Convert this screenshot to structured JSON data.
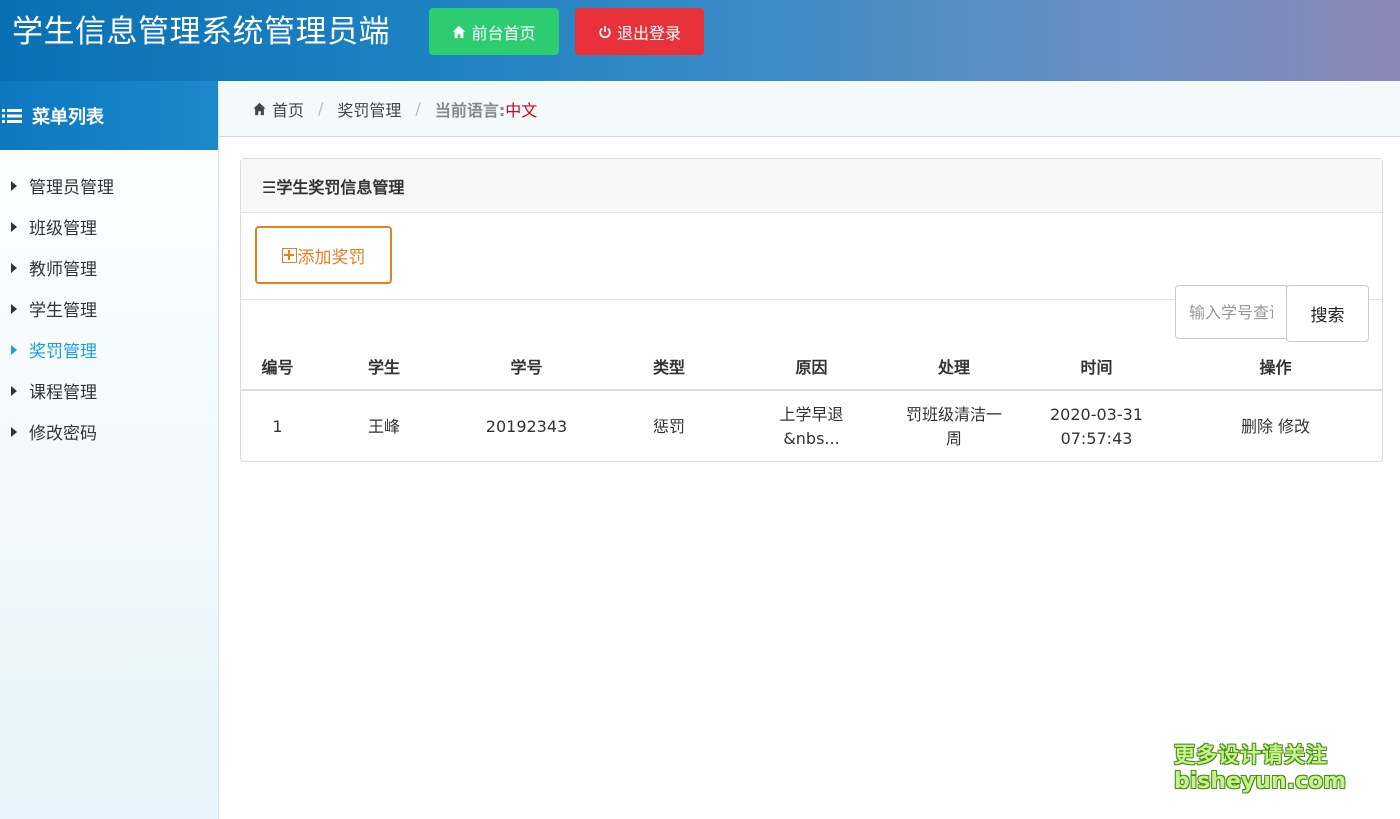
{
  "header": {
    "title": "学生信息管理系统管理员端",
    "home_button": "前台首页",
    "logout_button": "退出登录"
  },
  "sidebar": {
    "title": "菜单列表",
    "items": [
      {
        "label": "管理员管理"
      },
      {
        "label": "班级管理"
      },
      {
        "label": "教师管理"
      },
      {
        "label": "学生管理"
      },
      {
        "label": "奖罚管理"
      },
      {
        "label": "课程管理"
      },
      {
        "label": "修改密码"
      }
    ],
    "active_index": 4
  },
  "breadcrumb": {
    "home": "首页",
    "current": "奖罚管理",
    "lang_label": "当前语言:",
    "lang_value": "中文"
  },
  "panel": {
    "title": "☰学生奖罚信息管理",
    "add_button": "添加奖罚",
    "search": {
      "placeholder": "输入学号查询",
      "button": "搜索"
    }
  },
  "table": {
    "headers": [
      "编号",
      "学生",
      "学号",
      "类型",
      "原因",
      "处理",
      "时间",
      "操作"
    ],
    "rows": [
      {
        "id": "1",
        "student": "王峰",
        "student_no": "20192343",
        "type": "惩罚",
        "reason": "上学早退 &nbs...",
        "handling": "罚班级清洁一周",
        "time": "2020-03-31 07:57:43",
        "op_delete": "删除",
        "op_edit": "修改"
      }
    ]
  },
  "watermark": {
    "line1": "更多设计请关注",
    "line2": "bisheyun.com"
  },
  "colors": {
    "header_start": "#0a70b5",
    "header_end": "#8b88b8",
    "home_button": "#2ecc71",
    "logout_button": "#e8313a",
    "active_menu": "#1a9fd6",
    "add_button": "#e67e22",
    "lang_value": "#d0021b"
  }
}
